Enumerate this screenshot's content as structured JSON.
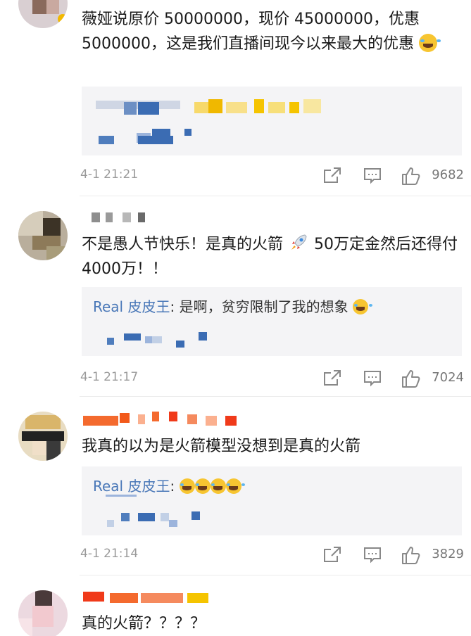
{
  "comments": [
    {
      "text": "薇娅说原价 50000000，现价 45000000，优惠 5000000，这是我们直播间现今以来最大的优惠",
      "emoji": "laughing-tears",
      "reply": {
        "user": "",
        "text": ""
      },
      "time": "4-1 21:21",
      "likes": "9682"
    },
    {
      "text_before": "不是愚人节快乐！是真的火箭",
      "emoji": "rocket",
      "text_after": " 50万定金然后还得付 4000万！！",
      "reply": {
        "user": "Real 皮皮王",
        "text": ": 是啊，贫穷限制了我的想象"
      },
      "time": "4-1 21:17",
      "likes": "7024"
    },
    {
      "text": "我真的以为是火箭模型没想到是真的火箭",
      "reply": {
        "user": "Real 皮皮王",
        "text": ":"
      },
      "time": "4-1 21:14",
      "likes": "3829"
    },
    {
      "text": "真的火箭？？？？"
    }
  ],
  "icons": {
    "share": "share-icon",
    "comment": "comment-icon",
    "like": "thumbs-up-icon"
  },
  "colors": {
    "reply_user": "#4a78b8",
    "time": "#9a9a9a",
    "reply_bg": "#f4f4f6"
  }
}
